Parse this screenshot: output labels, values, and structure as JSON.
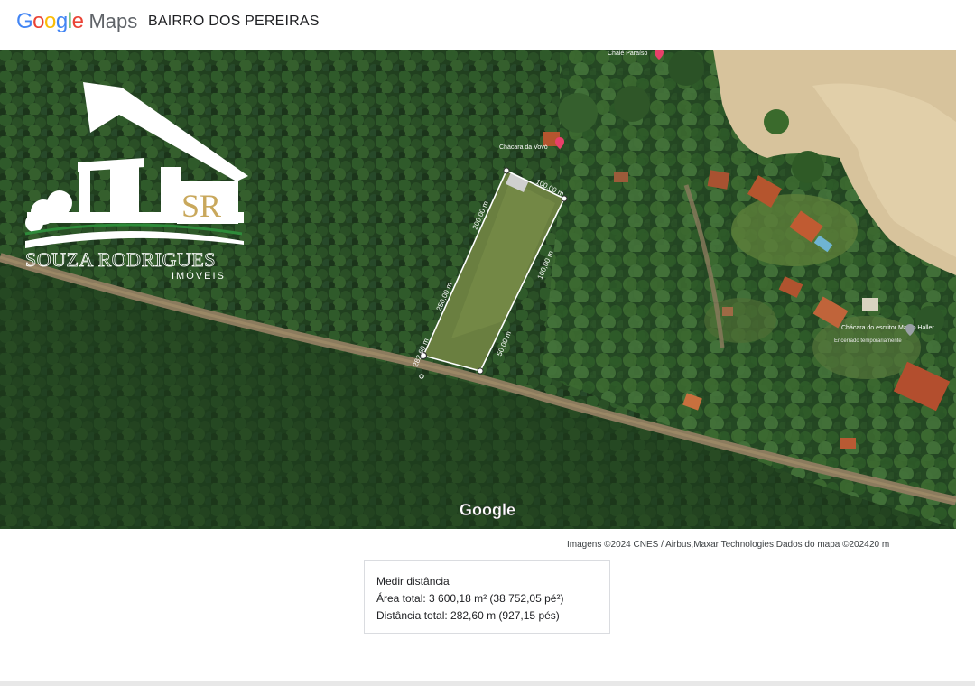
{
  "header": {
    "brand": {
      "google": "Google",
      "maps": "Maps"
    },
    "title": "BAIRRO DOS PEREIRAS"
  },
  "map": {
    "imagery": "satellite",
    "watermark": "Google",
    "overlay_logo": {
      "monogram": "SR",
      "company": "SOUZA RODRIGUES",
      "subtitle": "IMÓVEIS"
    },
    "places": [
      {
        "name": "Chalé Paraíso",
        "icon": "map-pin-icon"
      },
      {
        "name": "Chácara da Vovó",
        "icon": "map-pin-icon"
      },
      {
        "name": "Chácara do escritor Marco Haller",
        "note": "Encerrado temporariamente",
        "icon": "map-pin-icon"
      }
    ],
    "measurement_labels": [
      "100,00 m",
      "200,00 m",
      "100,00 m",
      "250,00 m",
      "50,00 m",
      "282,60 m"
    ]
  },
  "attribution": "Imagens ©2024 CNES / Airbus,Maxar Technologies,Dados do mapa ©2024",
  "scale_label": "20 m",
  "measure_panel": {
    "title": "Medir distância",
    "area": "Área total: 3 600,18 m² (38 752,05 pé²)",
    "distance": "Distância total: 282,60 m (927,15 pés)"
  },
  "colors": {
    "forest_dark": "#1f3a1f",
    "forest_mid": "#2f5a2a",
    "clearing": "#5e7a3a",
    "sand": "#d8c29a",
    "road": "#8a7a5e",
    "roof": "#b5552e",
    "measure_line": "#ffffff",
    "pin": "#e8406a"
  }
}
